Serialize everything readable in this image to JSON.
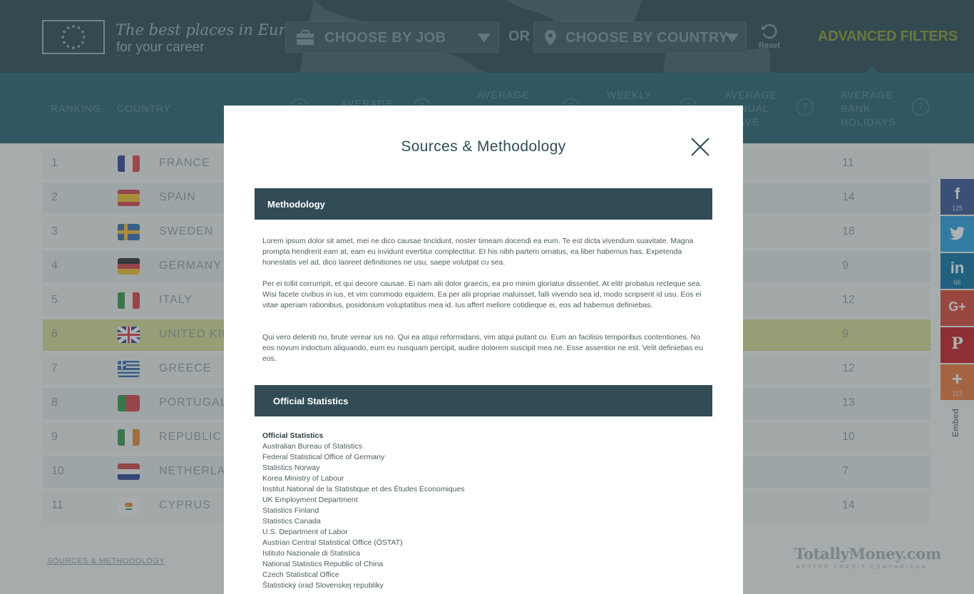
{
  "header": {
    "tagline_line1": "The best places in Europe",
    "tagline_line2": "for your career",
    "job_select": {
      "label": "CHOOSE BY JOB"
    },
    "or_text": "OR",
    "country_select": {
      "label": "CHOOSE BY COUNTRY"
    },
    "reset_label": "Reset",
    "advanced_filters": "ADVANCED FILTERS"
  },
  "columns": {
    "ranking": "RANKING",
    "country": "COUNTRY",
    "average": "AVERAGE",
    "average2": "AVERAGE",
    "weekly": "WEEKLY",
    "average_annual_leave": [
      "AVERAGE",
      "ANNUAL",
      "LEAVE"
    ],
    "average_bank_holidays": [
      "AVERAGE",
      "BANK",
      "HOLIDAYS"
    ],
    "info_glyph": "?"
  },
  "rows": [
    {
      "rank": "1",
      "country": "FRANCE",
      "holidays": "11",
      "flag": "france"
    },
    {
      "rank": "2",
      "country": "SPAIN",
      "holidays": "14",
      "flag": "spain"
    },
    {
      "rank": "3",
      "country": "SWEDEN",
      "holidays": "18",
      "flag": "sweden"
    },
    {
      "rank": "4",
      "country": "GERMANY",
      "holidays": "9",
      "flag": "germany"
    },
    {
      "rank": "5",
      "country": "ITALY",
      "holidays": "12",
      "flag": "italy"
    },
    {
      "rank": "6",
      "country": "UNITED KIN",
      "holidays": "9",
      "flag": "uk",
      "highlight": true
    },
    {
      "rank": "7",
      "country": "GREECE",
      "holidays": "12",
      "flag": "greece"
    },
    {
      "rank": "8",
      "country": "PORTUGAL",
      "holidays": "13",
      "flag": "portugal"
    },
    {
      "rank": "9",
      "country": "REPUBLIC C",
      "holidays": "10",
      "flag": "ireland"
    },
    {
      "rank": "10",
      "country": "NETHERLAN",
      "holidays": "7",
      "flag": "netherlands"
    },
    {
      "rank": "11",
      "country": "CYPRUS",
      "holidays": "14",
      "flag": "cyprus"
    }
  ],
  "footer": {
    "sources_link": "SOURCES & METHODOLOGY",
    "brand": "TotallyMoney.com",
    "brand_sub": "BETTER CREDIT COMPARISON"
  },
  "social": {
    "facebook": {
      "glyph": "f",
      "count": "125",
      "color": "#3b5998"
    },
    "twitter": {
      "glyph": "t",
      "count": "",
      "color": "#2ba3e3"
    },
    "linkedin": {
      "glyph": "in",
      "count": "66",
      "color": "#0e76a8"
    },
    "googleplus": {
      "glyph": "G+",
      "count": "",
      "color": "#dd4b39"
    },
    "pinterest": {
      "glyph": "P",
      "count": "",
      "color": "#cb2027"
    },
    "more": {
      "glyph": "+",
      "count": "112",
      "color": "#f07b3f"
    },
    "embed": "Embed"
  },
  "modal": {
    "title": "Sources & Methodology",
    "methodology_heading": "Methodology",
    "paragraphs": [
      "Lorem ipsum dolor sit amet, mei ne dico causae tincidunt, noster timeam docendi ea eum. Te est dicta vivendum suavitate. Magna prompta hendrerit eam at, eam eu invidunt evertitur complectitur. Et his nibh partem ornatus, ea liber habemus has. Expetenda honestatis vel ad, dico laoreet definitiones ne usu, saepe volutpat cu sea.",
      "Per ei tollit corrumpit, et qui decore causae. Ei nam alii dolor graecis, ea pro minim gloriatur dissentiet. At elitr probatus recteque sea. Wisi facete civibus in ius, et vim commodo equidem. Ea per alii propriae maluisset, falli vivendo sea id, modo scripserit id usu. Eos ei vitae aperiam rationibus, posidonium voluptatibus mea id. Ius affert meliore cotidieque ei, eos ad habemus definiebas.",
      "Qui vero deleniti no, brute verear ius no. Qui ea atqui reformidans, vim atqui putant cu. Eum an facilisis temporibus contentiones. No eos novum indoctum aliquando, eum eu nusquam percipit, audire dolorem suscipit mea ne. Esse assentior ne est. Velit definiebas eu eos."
    ],
    "stats_heading": "Official Statistics",
    "stats_subheading": "Official Statistics",
    "stats": [
      "Australian Bureau of Statistics",
      "Federal Statistical Office of Germany",
      "Statistics Norway",
      "Korea Ministry of Labour",
      "Institut National de la Statistique et des Études Économiques",
      "UK Employment Department",
      "Statistics Finland",
      "Statistics Canada",
      "U.S. Department of Labor",
      "Austrian Central Statistical Office (ÖSTAT)",
      "Istituto Nazionale di Statistica",
      "National Statistics Republic of China",
      "Czech Statistical Office",
      "Štatistický úrad Slovenskej republiky"
    ]
  }
}
